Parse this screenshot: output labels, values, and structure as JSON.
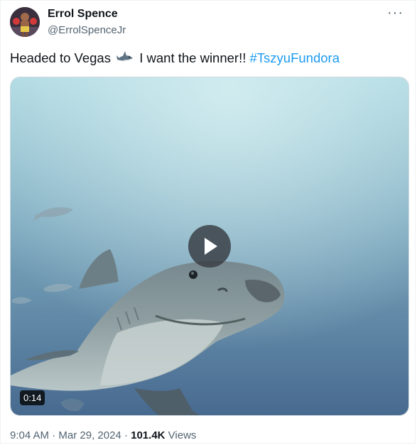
{
  "author": {
    "display_name": "Errol Spence",
    "handle": "@ErrolSpenceJr",
    "avatar_icon": "boxer-avatar"
  },
  "menu": {
    "more_label": "···",
    "icon": "more-dots-icon"
  },
  "tweet": {
    "text_before_emoji": "Headed to Vegas",
    "emoji": "shark-emoji",
    "text_after_emoji": " I want the winner!! ",
    "hashtag": "#TszyuFundora"
  },
  "media": {
    "type": "video",
    "description_icon": "shark-video-thumbnail",
    "play_icon": "play-icon",
    "duration": "0:14"
  },
  "footer": {
    "time": "9:04 AM",
    "separator": "·",
    "date": "Mar 29, 2024",
    "views_count": "101.4K",
    "views_label": "Views"
  },
  "colors": {
    "link": "#1d9bf0",
    "secondary_text": "#536471",
    "primary_text": "#0f1419"
  }
}
